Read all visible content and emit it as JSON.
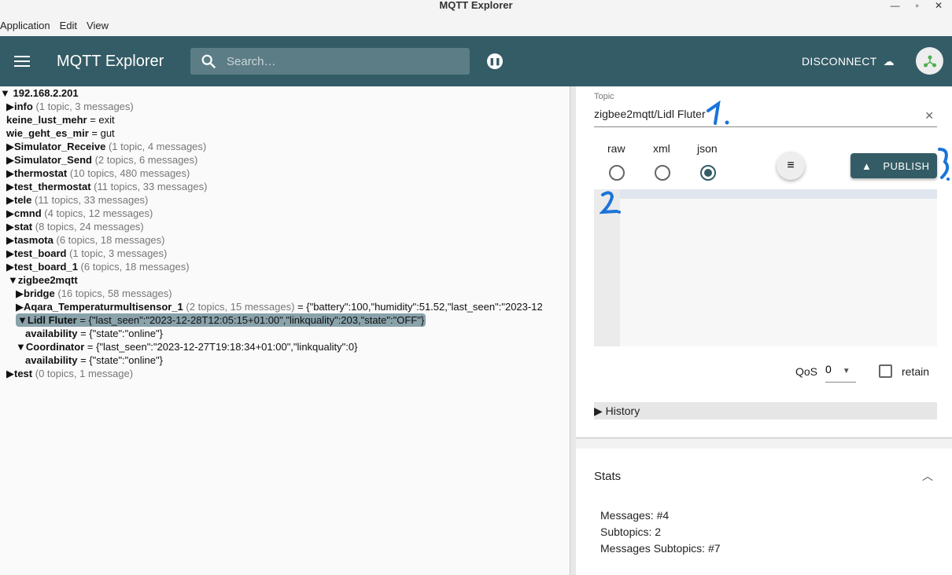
{
  "window": {
    "title": "MQTT Explorer"
  },
  "menu": [
    "Application",
    "Edit",
    "View"
  ],
  "appbar": {
    "title": "MQTT Explorer",
    "search_placeholder": "Search…",
    "disconnect": "DISCONNECT"
  },
  "tree": {
    "root": "192.168.2.201",
    "rows": [
      {
        "name": "info",
        "meta": "(1 topic, 3 messages)",
        "value": "",
        "arrow": "▶",
        "indent": 1
      },
      {
        "name": "keine_lust_mehr",
        "meta": "",
        "value": " = exit",
        "arrow": "",
        "indent": 1
      },
      {
        "name": "wie_geht_es_mir",
        "meta": "",
        "value": " = gut",
        "arrow": "",
        "indent": 1
      },
      {
        "name": "Simulator_Receive",
        "meta": "(1 topic, 4 messages)",
        "value": "",
        "arrow": "▶",
        "indent": 1
      },
      {
        "name": "Simulator_Send",
        "meta": "(2 topics, 6 messages)",
        "value": "",
        "arrow": "▶",
        "indent": 1
      },
      {
        "name": "thermostat",
        "meta": "(10 topics, 480 messages)",
        "value": "",
        "arrow": "▶",
        "indent": 1
      },
      {
        "name": "test_thermostat",
        "meta": "(11 topics, 33 messages)",
        "value": "",
        "arrow": "▶",
        "indent": 1
      },
      {
        "name": "tele",
        "meta": "(11 topics, 33 messages)",
        "value": "",
        "arrow": "▶",
        "indent": 1
      },
      {
        "name": "cmnd",
        "meta": "(4 topics, 12 messages)",
        "value": "",
        "arrow": "▶",
        "indent": 1
      },
      {
        "name": "stat",
        "meta": "(8 topics, 24 messages)",
        "value": "",
        "arrow": "▶",
        "indent": 1
      },
      {
        "name": "tasmota",
        "meta": "(6 topics, 18 messages)",
        "value": "",
        "arrow": "▶",
        "indent": 1
      },
      {
        "name": "test_board",
        "meta": "(1 topic, 3 messages)",
        "value": "",
        "arrow": "▶",
        "indent": 1
      },
      {
        "name": "test_board_1",
        "meta": "(6 topics, 18 messages)",
        "value": "",
        "arrow": "▶",
        "indent": 1
      },
      {
        "name": "zigbee2mqtt",
        "meta": "",
        "value": "",
        "arrow": "▼",
        "indent": 2
      },
      {
        "name": "bridge",
        "meta": "(16 topics, 58 messages)",
        "value": "",
        "arrow": "▶",
        "indent": 3
      },
      {
        "name": "Aqara_Temperaturmultisensor_1",
        "meta": "(2 topics, 15 messages)",
        "value": " = {\"battery\":100,\"humidity\":51.52,\"last_seen\":\"2023-12",
        "arrow": "▶",
        "indent": 3
      },
      {
        "name": "Lidl Fluter",
        "meta": "",
        "value": " = {\"last_seen\":\"2023-12-28T12:05:15+01:00\",\"linkquality\":203,\"state\":\"OFF\"}",
        "arrow": "▼",
        "indent": 3,
        "selected": true
      },
      {
        "name": "availability",
        "meta": "",
        "value": " = {\"state\":\"online\"}",
        "arrow": "",
        "indent": 4
      },
      {
        "name": "Coordinator",
        "meta": "",
        "value": " = {\"last_seen\":\"2023-12-27T19:18:34+01:00\",\"linkquality\":0}",
        "arrow": "▼",
        "indent": 3
      },
      {
        "name": "availability",
        "meta": "",
        "value": " = {\"state\":\"online\"}",
        "arrow": "",
        "indent": 4
      },
      {
        "name": "test",
        "meta": "(0 topics, 1 message)",
        "value": "",
        "arrow": "▶",
        "indent": 1
      }
    ]
  },
  "publish": {
    "topic_label": "Topic",
    "topic_value": "zigbee2mqtt/Lidl Fluter",
    "formats": [
      "raw",
      "xml",
      "json"
    ],
    "selected_format": "json",
    "publish_label": "PUBLISH",
    "qos_label": "QoS",
    "qos_value": "0",
    "retain_label": "retain",
    "history_label": "History",
    "annotations": [
      "1.",
      "2.",
      "3."
    ]
  },
  "stats": {
    "title": "Stats",
    "messages": "Messages: #4",
    "subtopics": "Subtopics: 2",
    "messages_subtopics": "Messages Subtopics: #7"
  },
  "colors": {
    "primary": "#345c66",
    "selection": "#8aa3ab",
    "annotation": "#1a73d9"
  }
}
